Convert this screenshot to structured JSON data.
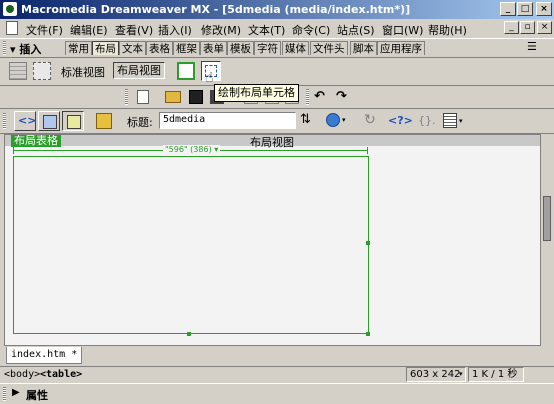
{
  "window": {
    "title": "Macromedia Dreamweaver MX - [5dmedia (media/index.htm*)]",
    "controls": {
      "minimize": "_",
      "maximize": "□",
      "close": "×"
    }
  },
  "menu": {
    "items": [
      "文件(F)",
      "编辑(E)",
      "查看(V)",
      "插入(I)",
      "修改(M)",
      "文本(T)",
      "命令(C)",
      "站点(S)",
      "窗口(W)",
      "帮助(H)"
    ],
    "doc_controls": {
      "minimize": "_",
      "restore": "▫",
      "close": "×"
    }
  },
  "insert_panel": {
    "label": "▾ 插入",
    "tabs": [
      "常用",
      "布局",
      "文本",
      "表格",
      "框架",
      "表单",
      "模板",
      "字符",
      "媒体",
      "文件头",
      "脚本",
      "应用程序"
    ],
    "active_tab": "布局",
    "menu_icon": "☰"
  },
  "layout_row": {
    "standard_view": "标准视图",
    "layout_view": "布局视图",
    "tooltip": "绘制布局单元格"
  },
  "document_toolbar": {
    "title_label": "标题:",
    "title_value": "5dmedia"
  },
  "canvas": {
    "header": "布局视图",
    "layout_table_tab": "布局表格",
    "width_label": "\"596\" (386) ▾"
  },
  "doc_tab": {
    "label": "index.htm *"
  },
  "status": {
    "tag_body": "<body>",
    "tag_table": "<table>",
    "window_size": "603 x 242",
    "file_info": "1 K / 1 秒"
  },
  "properties": {
    "label": "属性"
  },
  "colors": {
    "title_start": "#0a246a",
    "title_end": "#a6caf0",
    "layout_green": "#2a9d2a",
    "chrome": "#d4d0c8"
  }
}
